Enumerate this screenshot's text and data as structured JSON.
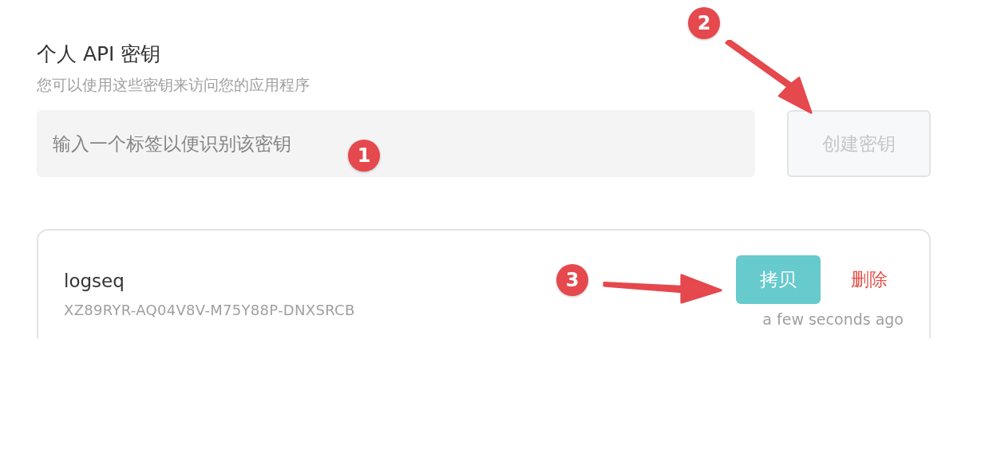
{
  "section": {
    "title": "个人 API 密钥",
    "subtitle": "您可以使用这些密钥来访问您的应用程序"
  },
  "label_field": {
    "placeholder": "输入一个标签以便识别该密钥"
  },
  "create_button": {
    "label": "创建密钥",
    "disabled": true
  },
  "keys": [
    {
      "name": "logseq",
      "key": "XZ89RYR-AQ04V8V-M75Y88P-DNXSRCB",
      "copy_label": "拷贝",
      "delete_label": "删除",
      "created": "a few seconds ago"
    }
  ],
  "callouts": [
    {
      "label": "1"
    },
    {
      "label": "2"
    },
    {
      "label": "3"
    }
  ]
}
